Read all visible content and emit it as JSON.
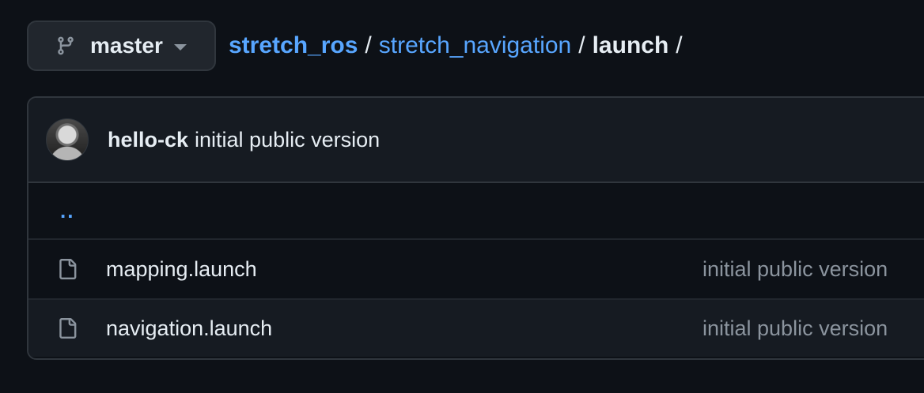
{
  "branch": {
    "name": "master",
    "icon": "git-branch-icon"
  },
  "breadcrumb": {
    "repo": "stretch_ros",
    "folder": "stretch_navigation",
    "current": "launch",
    "separator": "/"
  },
  "latest_commit": {
    "author": "hello-ck",
    "message": "initial public version"
  },
  "parent_dir": "..",
  "files": [
    {
      "name": "mapping.launch",
      "icon": "file-icon",
      "commit_message": "initial public version"
    },
    {
      "name": "navigation.launch",
      "icon": "file-icon",
      "commit_message": "initial public version"
    }
  ],
  "colors": {
    "background": "#0d1117",
    "link": "#58a6ff",
    "muted": "#8b949e",
    "border": "#30363d"
  }
}
